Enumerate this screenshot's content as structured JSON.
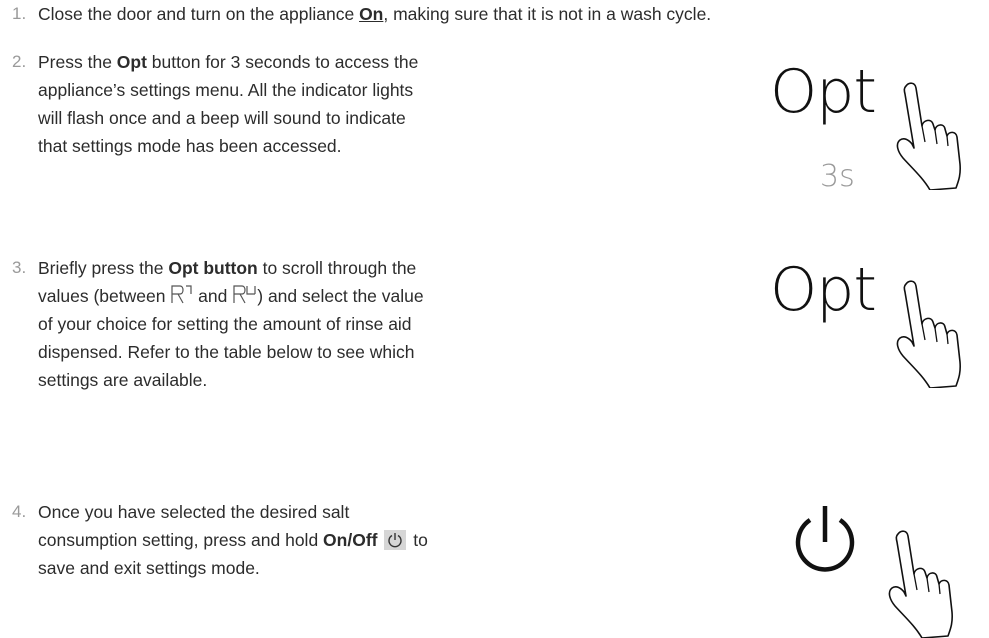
{
  "steps": [
    {
      "number": "1.",
      "pre": "Close the door and turn on the appliance ",
      "bold_underline": "On",
      "post": ", making sure that it is not in a wash cycle."
    },
    {
      "number": "2.",
      "pre": "Press the ",
      "bold": "Opt",
      "post_line1": " button for 3 seconds to access the",
      "line2": "appliance’s settings menu. All the indicator lights",
      "line3": "will flash once and a beep will sound to indicate",
      "line4": "that settings mode has been accessed.",
      "illustration": {
        "label": "Opt",
        "duration": "3s",
        "icon": "hand-pointer-icon"
      }
    },
    {
      "number": "3.",
      "pre": "Briefly press the ",
      "bold": "Opt button",
      "post_line1": " to scroll through the",
      "line2_pre": "values (between ",
      "value_from": "R1",
      "line2_mid": " and ",
      "value_to": "R4",
      "line2_post": ") and select the value",
      "line3": "of your choice for setting the amount of rinse aid",
      "line4": "dispensed. Refer to the table below to see which",
      "line5": "settings are available.",
      "illustration": {
        "label": "Opt",
        "icon": "hand-pointer-icon"
      }
    },
    {
      "number": "4.",
      "line1": "Once you have selected the desired salt",
      "line2_pre": "consumption setting, press and hold ",
      "bold": "On/Off",
      "line2_post": " to",
      "line3": "save and exit settings mode.",
      "illustration": {
        "icon": "power-icon",
        "hand": "hand-pointer-icon"
      }
    }
  ]
}
